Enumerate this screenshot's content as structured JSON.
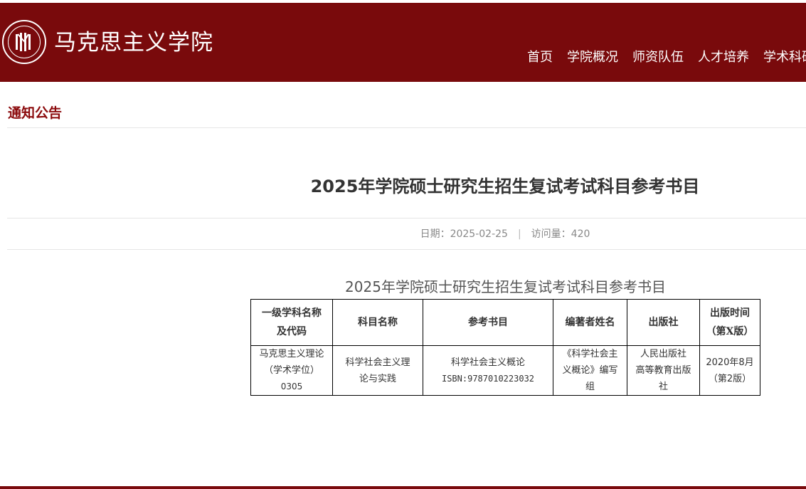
{
  "header": {
    "site_title": "马克思主义学院",
    "nav": [
      "首页",
      "学院概况",
      "师资队伍",
      "人才培养",
      "学术科研"
    ]
  },
  "section": {
    "title": "通知公告"
  },
  "article": {
    "title": "2025年学院硕士研究生招生复试考试科目参考书目",
    "date_label": "日期：2025-02-25",
    "separator": "|",
    "views_label": "访问量：420"
  },
  "table": {
    "caption": "2025年学院硕士研究生招生复试考试科目参考书目",
    "headers": [
      [
        "一级学科名称",
        "及代码"
      ],
      [
        "科目名称"
      ],
      [
        "参考书目"
      ],
      [
        "编著者姓名"
      ],
      [
        "出版社"
      ],
      [
        "出版时间",
        "（第X版）"
      ]
    ],
    "row": {
      "subject": [
        "马克思主义理论",
        "（学术学位）",
        "0305"
      ],
      "course": [
        "科学社会主义理",
        "论与实践"
      ],
      "book": [
        "科学社会主义概论",
        "ISBN:9787010223032"
      ],
      "author": [
        "《科学社会主",
        "义概论》编写",
        "组"
      ],
      "publisher": [
        "人民出版社",
        "高等教育出版",
        "社"
      ],
      "pub_time": [
        "2020年8月",
        "（第2版）"
      ]
    }
  },
  "colors": {
    "brand": "#790a0c",
    "section_title": "#8b0a0c"
  },
  "icons": {
    "logo": "school-emblem-icon"
  }
}
